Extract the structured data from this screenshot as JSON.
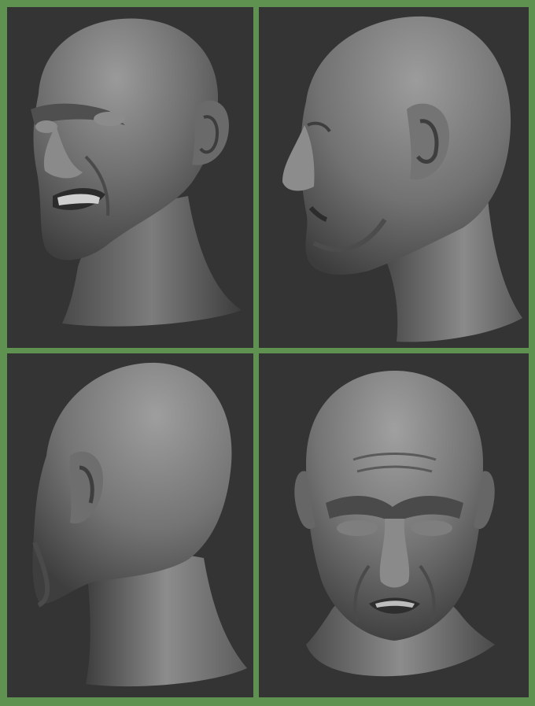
{
  "views": [
    {
      "view": "three-quarter-front"
    },
    {
      "view": "side-profile"
    },
    {
      "view": "three-quarter-back"
    },
    {
      "view": "front"
    }
  ],
  "colors": {
    "frame": "#5f9150",
    "panel_background": "#343434",
    "clay_light": "#8e8e8e",
    "clay_mid": "#6e6e6e",
    "clay_dark": "#444444"
  }
}
